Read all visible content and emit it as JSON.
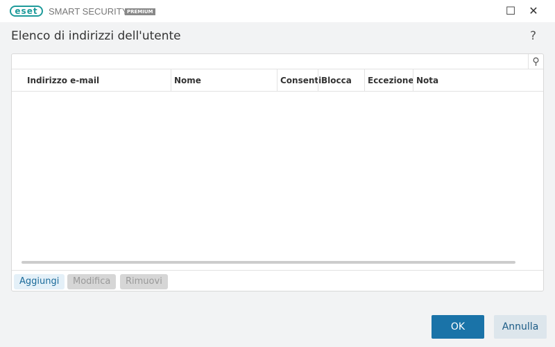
{
  "titlebar": {
    "logo": "eset",
    "product": "SMART SECURITY",
    "edition": "PREMIUM",
    "minimize": "☐",
    "close": "✕"
  },
  "dialog": {
    "title": "Elenco di indirizzi dell'utente",
    "help": "?"
  },
  "table": {
    "search_value": "",
    "columns": [
      "Indirizzo e-mail",
      "Nome",
      "Consenti",
      "Blocca",
      "Eccezione",
      "Nota"
    ],
    "rows": []
  },
  "buttons": {
    "add": "Aggiungi",
    "edit": "Modifica",
    "remove": "Rimuovi",
    "ok": "OK",
    "cancel": "Annulla"
  },
  "colors": {
    "accent": "#1a73a8",
    "brand": "#1d9a9a"
  }
}
